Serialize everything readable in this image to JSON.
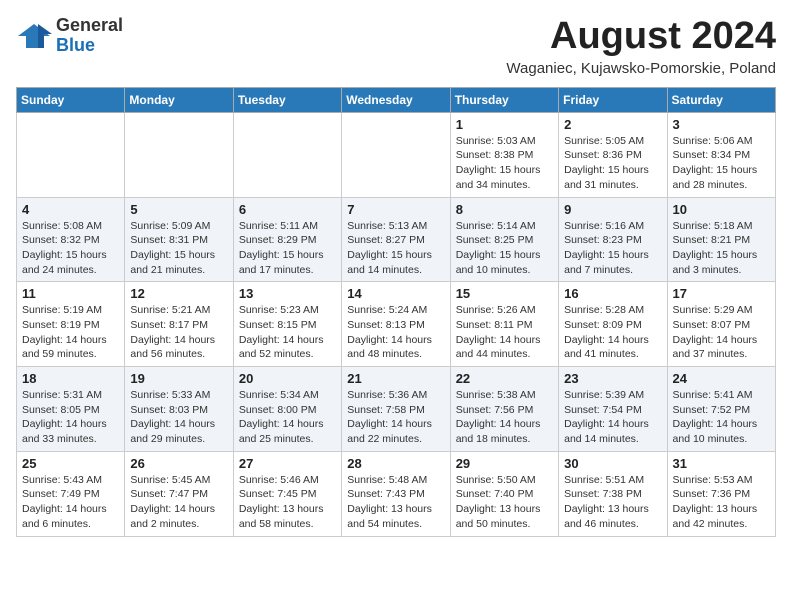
{
  "header": {
    "logo_general": "General",
    "logo_blue": "Blue",
    "month_year": "August 2024",
    "location": "Waganiec, Kujawsko-Pomorskie, Poland"
  },
  "days_of_week": [
    "Sunday",
    "Monday",
    "Tuesday",
    "Wednesday",
    "Thursday",
    "Friday",
    "Saturday"
  ],
  "weeks": [
    [
      {
        "day": "",
        "info": ""
      },
      {
        "day": "",
        "info": ""
      },
      {
        "day": "",
        "info": ""
      },
      {
        "day": "",
        "info": ""
      },
      {
        "day": "1",
        "info": "Sunrise: 5:03 AM\nSunset: 8:38 PM\nDaylight: 15 hours\nand 34 minutes."
      },
      {
        "day": "2",
        "info": "Sunrise: 5:05 AM\nSunset: 8:36 PM\nDaylight: 15 hours\nand 31 minutes."
      },
      {
        "day": "3",
        "info": "Sunrise: 5:06 AM\nSunset: 8:34 PM\nDaylight: 15 hours\nand 28 minutes."
      }
    ],
    [
      {
        "day": "4",
        "info": "Sunrise: 5:08 AM\nSunset: 8:32 PM\nDaylight: 15 hours\nand 24 minutes."
      },
      {
        "day": "5",
        "info": "Sunrise: 5:09 AM\nSunset: 8:31 PM\nDaylight: 15 hours\nand 21 minutes."
      },
      {
        "day": "6",
        "info": "Sunrise: 5:11 AM\nSunset: 8:29 PM\nDaylight: 15 hours\nand 17 minutes."
      },
      {
        "day": "7",
        "info": "Sunrise: 5:13 AM\nSunset: 8:27 PM\nDaylight: 15 hours\nand 14 minutes."
      },
      {
        "day": "8",
        "info": "Sunrise: 5:14 AM\nSunset: 8:25 PM\nDaylight: 15 hours\nand 10 minutes."
      },
      {
        "day": "9",
        "info": "Sunrise: 5:16 AM\nSunset: 8:23 PM\nDaylight: 15 hours\nand 7 minutes."
      },
      {
        "day": "10",
        "info": "Sunrise: 5:18 AM\nSunset: 8:21 PM\nDaylight: 15 hours\nand 3 minutes."
      }
    ],
    [
      {
        "day": "11",
        "info": "Sunrise: 5:19 AM\nSunset: 8:19 PM\nDaylight: 14 hours\nand 59 minutes."
      },
      {
        "day": "12",
        "info": "Sunrise: 5:21 AM\nSunset: 8:17 PM\nDaylight: 14 hours\nand 56 minutes."
      },
      {
        "day": "13",
        "info": "Sunrise: 5:23 AM\nSunset: 8:15 PM\nDaylight: 14 hours\nand 52 minutes."
      },
      {
        "day": "14",
        "info": "Sunrise: 5:24 AM\nSunset: 8:13 PM\nDaylight: 14 hours\nand 48 minutes."
      },
      {
        "day": "15",
        "info": "Sunrise: 5:26 AM\nSunset: 8:11 PM\nDaylight: 14 hours\nand 44 minutes."
      },
      {
        "day": "16",
        "info": "Sunrise: 5:28 AM\nSunset: 8:09 PM\nDaylight: 14 hours\nand 41 minutes."
      },
      {
        "day": "17",
        "info": "Sunrise: 5:29 AM\nSunset: 8:07 PM\nDaylight: 14 hours\nand 37 minutes."
      }
    ],
    [
      {
        "day": "18",
        "info": "Sunrise: 5:31 AM\nSunset: 8:05 PM\nDaylight: 14 hours\nand 33 minutes."
      },
      {
        "day": "19",
        "info": "Sunrise: 5:33 AM\nSunset: 8:03 PM\nDaylight: 14 hours\nand 29 minutes."
      },
      {
        "day": "20",
        "info": "Sunrise: 5:34 AM\nSunset: 8:00 PM\nDaylight: 14 hours\nand 25 minutes."
      },
      {
        "day": "21",
        "info": "Sunrise: 5:36 AM\nSunset: 7:58 PM\nDaylight: 14 hours\nand 22 minutes."
      },
      {
        "day": "22",
        "info": "Sunrise: 5:38 AM\nSunset: 7:56 PM\nDaylight: 14 hours\nand 18 minutes."
      },
      {
        "day": "23",
        "info": "Sunrise: 5:39 AM\nSunset: 7:54 PM\nDaylight: 14 hours\nand 14 minutes."
      },
      {
        "day": "24",
        "info": "Sunrise: 5:41 AM\nSunset: 7:52 PM\nDaylight: 14 hours\nand 10 minutes."
      }
    ],
    [
      {
        "day": "25",
        "info": "Sunrise: 5:43 AM\nSunset: 7:49 PM\nDaylight: 14 hours\nand 6 minutes."
      },
      {
        "day": "26",
        "info": "Sunrise: 5:45 AM\nSunset: 7:47 PM\nDaylight: 14 hours\nand 2 minutes."
      },
      {
        "day": "27",
        "info": "Sunrise: 5:46 AM\nSunset: 7:45 PM\nDaylight: 13 hours\nand 58 minutes."
      },
      {
        "day": "28",
        "info": "Sunrise: 5:48 AM\nSunset: 7:43 PM\nDaylight: 13 hours\nand 54 minutes."
      },
      {
        "day": "29",
        "info": "Sunrise: 5:50 AM\nSunset: 7:40 PM\nDaylight: 13 hours\nand 50 minutes."
      },
      {
        "day": "30",
        "info": "Sunrise: 5:51 AM\nSunset: 7:38 PM\nDaylight: 13 hours\nand 46 minutes."
      },
      {
        "day": "31",
        "info": "Sunrise: 5:53 AM\nSunset: 7:36 PM\nDaylight: 13 hours\nand 42 minutes."
      }
    ]
  ]
}
